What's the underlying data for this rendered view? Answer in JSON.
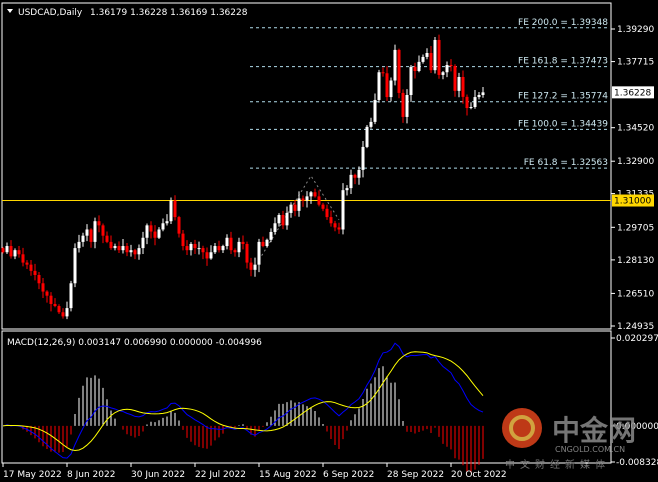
{
  "header": {
    "symbol": "USDCAD,Daily",
    "ohlc": "1.36179 1.36228 1.36169 1.36228"
  },
  "macd_header": "MACD(12,26,9) 0.003147 0.006990 0.000000 -0.004996",
  "watermark": {
    "brand": "中金网",
    "domain": "CNGOLD.COM.CN",
    "tagline": "中文财经新媒体"
  },
  "colors": {
    "bull": "#ffffff",
    "bear": "#ff0000",
    "level": "#ffd700",
    "fib": "#b0dcea",
    "macd": "#0000ff",
    "signal": "#ffff00",
    "background": "#000000"
  },
  "chart_data": [
    {
      "type": "candlestick",
      "title": "USDCAD,Daily",
      "x_tick_labels": [
        {
          "bar": 0,
          "label": "17 May 2022"
        },
        {
          "bar": 16,
          "label": "8 Jun 2022"
        },
        {
          "bar": 32,
          "label": "30 Jun 2022"
        },
        {
          "bar": 48,
          "label": "22 Jul 2022"
        },
        {
          "bar": 64,
          "label": "15 Aug 2022"
        },
        {
          "bar": 80,
          "label": "6 Sep 2022"
        },
        {
          "bar": 96,
          "label": "28 Sep 2022"
        },
        {
          "bar": 112,
          "label": "20 Oct 2022"
        }
      ],
      "y_range": [
        1.24935,
        1.3929
      ],
      "y_tick_labels": [
        "1.39290",
        "1.37715",
        "1.34520",
        "1.32900",
        "1.31335",
        "1.29705",
        "1.28130",
        "1.26510",
        "1.24935"
      ],
      "current_price": "1.36228",
      "horizontal_level": "1.31000",
      "close": [
        1.285,
        1.288,
        1.283,
        1.286,
        1.284,
        1.28,
        1.279,
        1.276,
        1.274,
        1.27,
        1.266,
        1.264,
        1.26,
        1.259,
        1.256,
        1.254,
        1.258,
        1.27,
        1.287,
        1.29,
        1.293,
        1.296,
        1.29,
        1.3,
        1.298,
        1.293,
        1.29,
        1.287,
        1.288,
        1.286,
        1.288,
        1.285,
        1.286,
        1.284,
        1.287,
        1.292,
        1.298,
        1.295,
        1.292,
        1.296,
        1.299,
        1.3,
        1.31,
        1.302,
        1.294,
        1.288,
        1.286,
        1.289,
        1.287,
        1.287,
        1.285,
        1.282,
        1.285,
        1.288,
        1.286,
        1.288,
        1.292,
        1.286,
        1.285,
        1.29,
        1.289,
        1.28,
        1.2765,
        1.279,
        1.29,
        1.288,
        1.291,
        1.2948,
        1.299,
        1.303,
        1.298,
        1.304,
        1.308,
        1.305,
        1.311,
        1.31,
        1.312,
        1.314,
        1.312,
        1.308,
        1.306,
        1.302,
        1.299,
        1.297,
        1.296,
        1.315,
        1.316,
        1.3224,
        1.321,
        1.3248,
        1.3359,
        1.3456,
        1.348,
        1.3586,
        1.372,
        1.3715,
        1.36,
        1.368,
        1.3828,
        1.362,
        1.3504,
        1.361,
        1.3746,
        1.3726,
        1.377,
        1.3794,
        1.3813,
        1.373,
        1.3876,
        1.3707,
        1.372,
        1.3755,
        1.375,
        1.363,
        1.3697,
        1.3601,
        1.3547,
        1.3552,
        1.36,
        1.361,
        1.36228
      ],
      "fibonacci_expansion": {
        "anchors": [
          {
            "bar": 64,
            "price": 1.2813
          },
          {
            "bar": 77,
            "price": 1.3219
          },
          {
            "bar": 84,
            "price": 1.3007
          }
        ],
        "levels": [
          {
            "label": "FE 200.0 = 1.39348",
            "price": 1.39348
          },
          {
            "label": "FE 161.8 = 1.37473",
            "price": 1.37473
          },
          {
            "label": "FE 127.2 = 1.35774",
            "price": 1.35774
          },
          {
            "label": "FE 100.0 = 1.34439",
            "price": 1.34439
          },
          {
            "label": "FE 61.8 = 1.32563",
            "price": 1.32563
          }
        ]
      }
    },
    {
      "type": "macd",
      "params": [
        12,
        26,
        9
      ],
      "y_range": [
        -0.008328,
        0.020297
      ],
      "y_tick_labels": [
        "0.020297",
        "0.000000",
        "-0.008328"
      ]
    }
  ]
}
